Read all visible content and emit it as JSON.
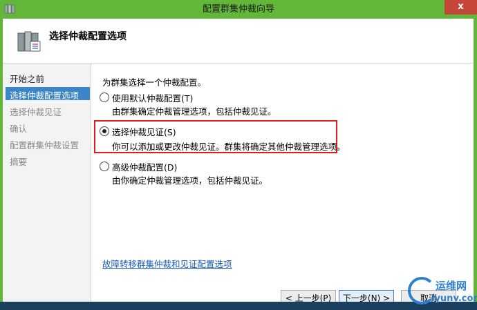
{
  "window": {
    "title": "配置群集仲裁向导",
    "close_glyph": "x"
  },
  "header": {
    "title": "选择仲裁配置选项"
  },
  "nav": {
    "items": [
      {
        "label": "开始之前",
        "state": "done"
      },
      {
        "label": "选择仲裁配置选项",
        "state": "active"
      },
      {
        "label": "选择仲裁见证",
        "state": "pending"
      },
      {
        "label": "确认",
        "state": "pending"
      },
      {
        "label": "配置群集仲裁设置",
        "state": "pending"
      },
      {
        "label": "摘要",
        "state": "pending"
      }
    ]
  },
  "content": {
    "intro": "为群集选择一个仲裁配置。",
    "options": [
      {
        "label": "使用默认仲裁配置(T)",
        "desc": "由群集确定仲裁管理选项，包括仲裁见证。",
        "checked": false
      },
      {
        "label": "选择仲裁见证(S)",
        "desc": "你可以添加或更改仲裁见证。群集将确定其他仲裁管理选项。",
        "checked": true
      },
      {
        "label": "高级仲裁配置(D)",
        "desc": "由你确定仲裁管理选项，包括仲裁见证。",
        "checked": false
      }
    ],
    "link": "故障转移群集仲裁和见证配置选项"
  },
  "buttons": {
    "prev": "< 上一步(P)",
    "next": "下一步(N) >",
    "cancel": "取消"
  },
  "watermark": {
    "line1": "运维网",
    "line2": "iyunv.com"
  },
  "colors": {
    "titlebar": "#62b63a",
    "close": "#c7463a",
    "nav_active": "#3a86c8",
    "highlight": "#e01b1b",
    "link": "#1a5ab8"
  }
}
